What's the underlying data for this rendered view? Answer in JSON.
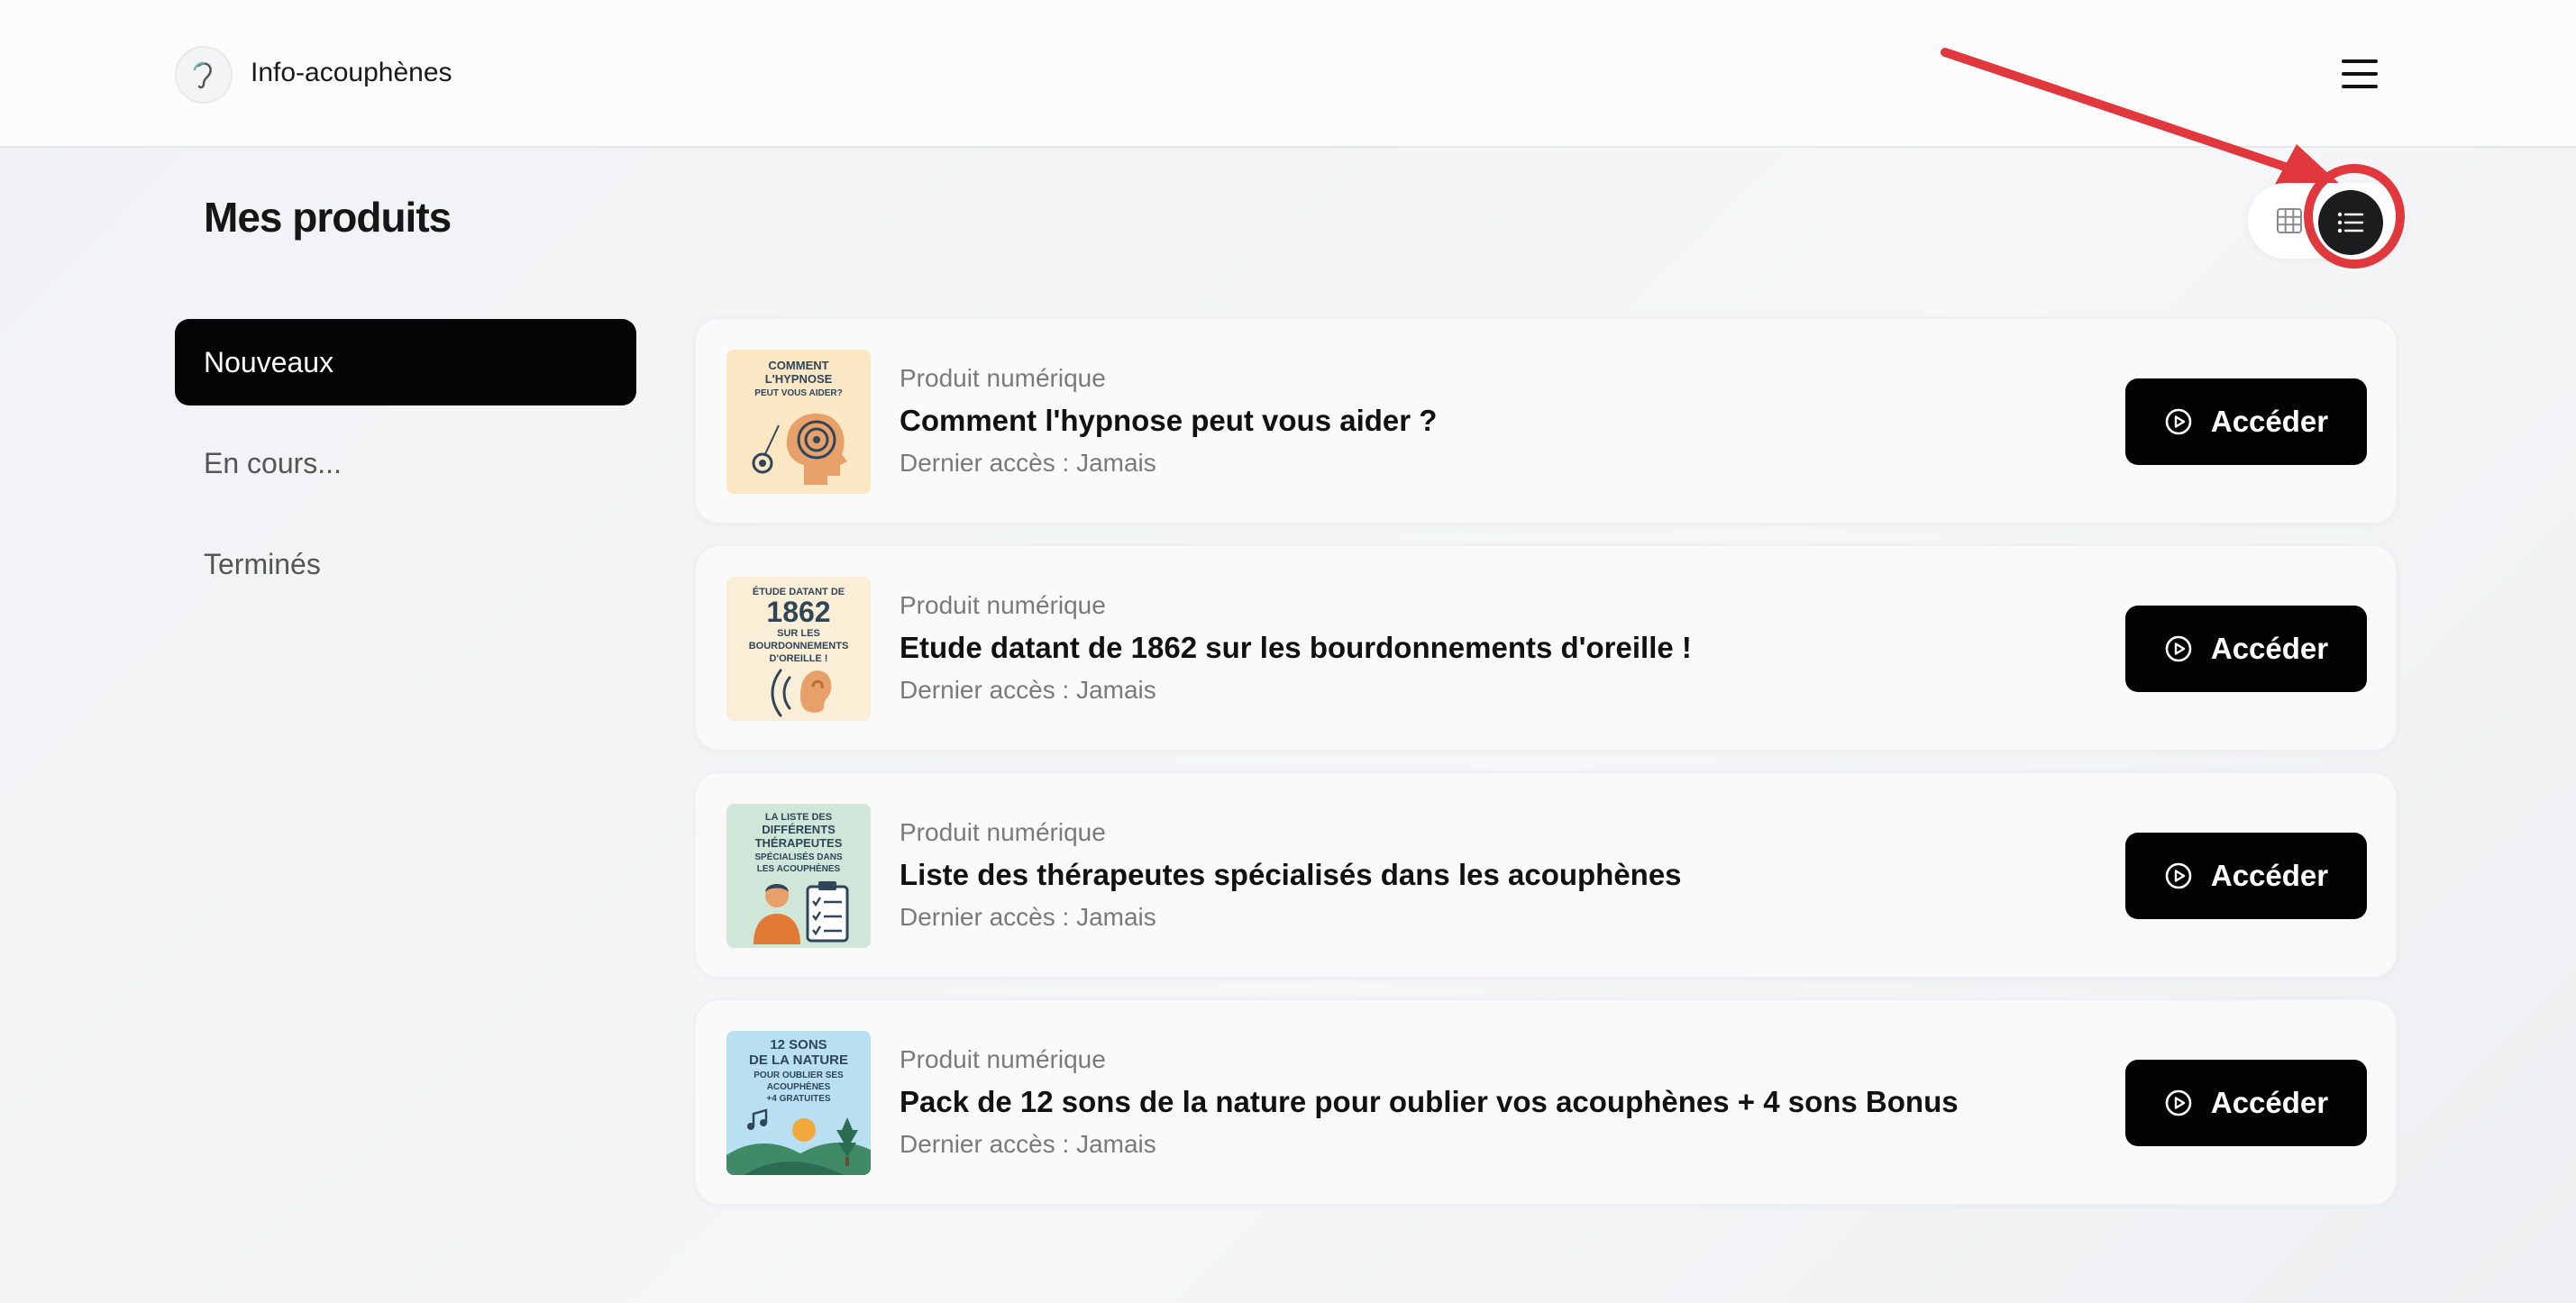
{
  "header": {
    "brand": "Info-acouphènes",
    "menu_icon": "hamburger-menu-icon"
  },
  "page": {
    "title": "Mes produits"
  },
  "view_toggle": {
    "grid_icon": "grid-icon",
    "list_icon": "list-icon",
    "selected": "list"
  },
  "sidebar": {
    "items": [
      {
        "label": "Nouveaux",
        "active": true
      },
      {
        "label": "En cours...",
        "active": false
      },
      {
        "label": "Terminés",
        "active": false
      }
    ]
  },
  "products": [
    {
      "type": "Produit numérique",
      "title": "Comment l'hypnose peut vous aider ?",
      "last_access": "Dernier accès : Jamais",
      "button": "Accéder",
      "thumb_lines": [
        "COMMENT",
        "L'HYPNOSE",
        "PEUT VOUS AIDER?"
      ]
    },
    {
      "type": "Produit numérique",
      "title": "Etude datant de 1862 sur les bourdonnements d'oreille !",
      "last_access": "Dernier accès : Jamais",
      "button": "Accéder",
      "thumb_lines": [
        "ÉTUDE DATANT DE",
        "1862",
        "SUR LES",
        "BOURDONNEMENTS",
        "D'OREILLE !"
      ]
    },
    {
      "type": "Produit numérique",
      "title": "Liste des thérapeutes spécialisés dans les acouphènes",
      "last_access": "Dernier accès : Jamais",
      "button": "Accéder",
      "thumb_lines": [
        "LA LISTE DES",
        "DIFFÉRENTS",
        "THÉRAPEUTES",
        "SPÉCIALISÉS DANS",
        "LES ACOUPHÈNES"
      ]
    },
    {
      "type": "Produit numérique",
      "title": "Pack de 12 sons de la nature pour oublier vos acouphènes + 4 sons Bonus",
      "last_access": "Dernier accès : Jamais",
      "button": "Accéder",
      "thumb_lines": [
        "12 SONS",
        "DE LA NATURE",
        "POUR OUBLIER SES",
        "ACOUPHÈNES",
        "+4 GRATUITES"
      ]
    }
  ],
  "colors": {
    "accent": "#e0383d",
    "button": "#030303",
    "active_tab": "#050505"
  }
}
